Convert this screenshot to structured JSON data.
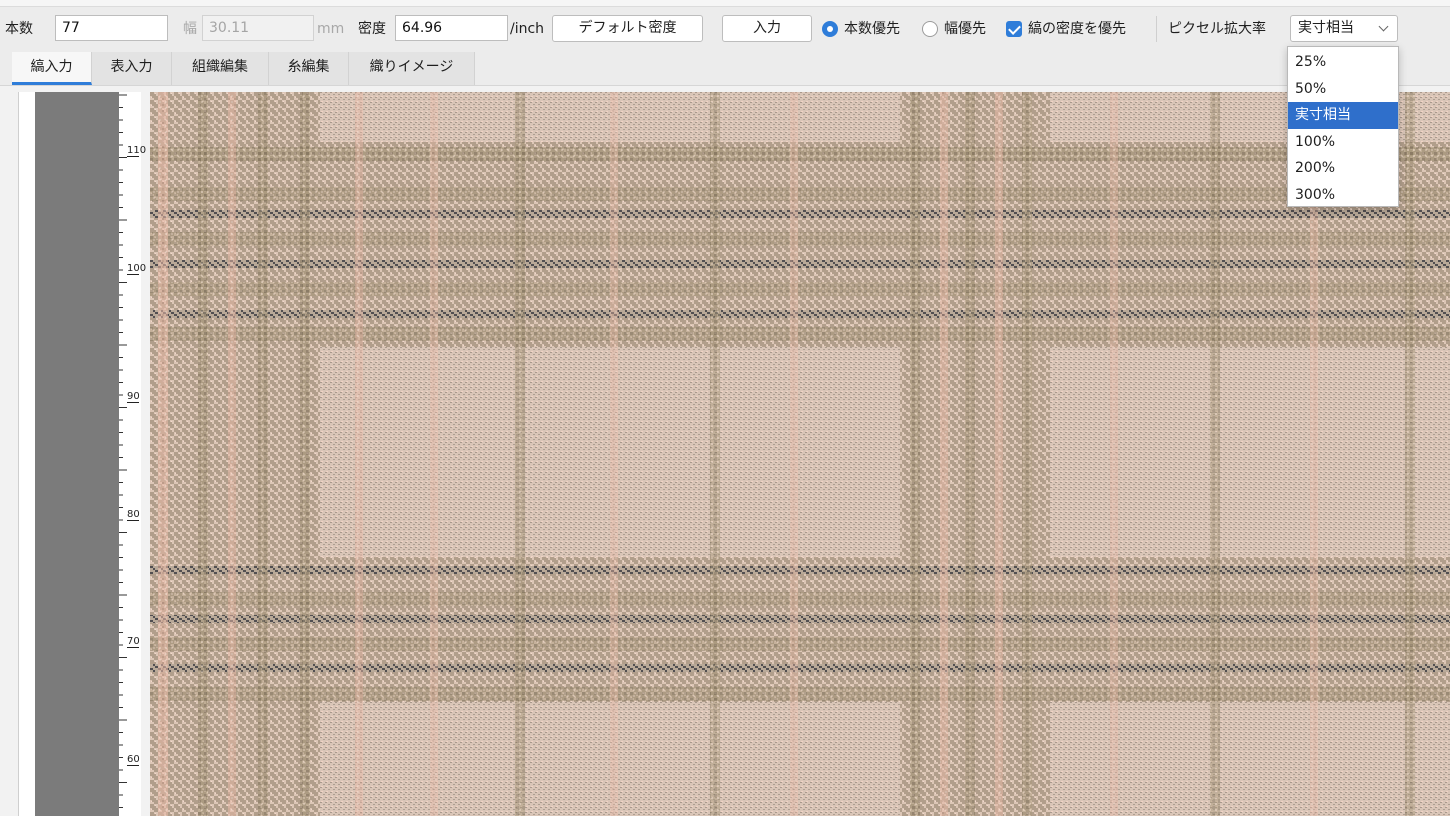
{
  "toolbar": {
    "count_label": "本数",
    "count_value": "77",
    "width_label": "幅",
    "width_value": "30.11",
    "width_unit": "mm",
    "density_label": "密度",
    "density_value": "64.96",
    "density_unit": "/inch",
    "default_density_button": "デフォルト密度",
    "input_button": "入力",
    "priority_count_label": "本数優先",
    "priority_width_label": "幅優先",
    "stripe_density_priority_label": "縞の密度を優先",
    "pixel_scale_label": "ピクセル拡大率",
    "pixel_scale_value": "実寸相当",
    "priority_selected": "count",
    "stripe_density_priority_checked": true
  },
  "tabs": [
    {
      "label": "縞入力",
      "active": true
    },
    {
      "label": "表入力",
      "active": false
    },
    {
      "label": "組織編集",
      "active": false
    },
    {
      "label": "糸編集",
      "active": false
    },
    {
      "label": "織りイメージ",
      "active": false
    }
  ],
  "dropdown": {
    "open": true,
    "options": [
      "25%",
      "50%",
      "実寸相当",
      "100%",
      "200%",
      "300%"
    ],
    "selected_index": 2
  },
  "ruler": {
    "labels": [
      "110",
      "100",
      "90",
      "80",
      "70",
      "60"
    ]
  },
  "colors": {
    "accent": "#2f7dd9",
    "fabric_base": "#d8c2b2",
    "fabric_pink": "#e9b8a6",
    "fabric_khaki": "#9a8a6a",
    "fabric_charcoal": "#4a4a4e"
  }
}
